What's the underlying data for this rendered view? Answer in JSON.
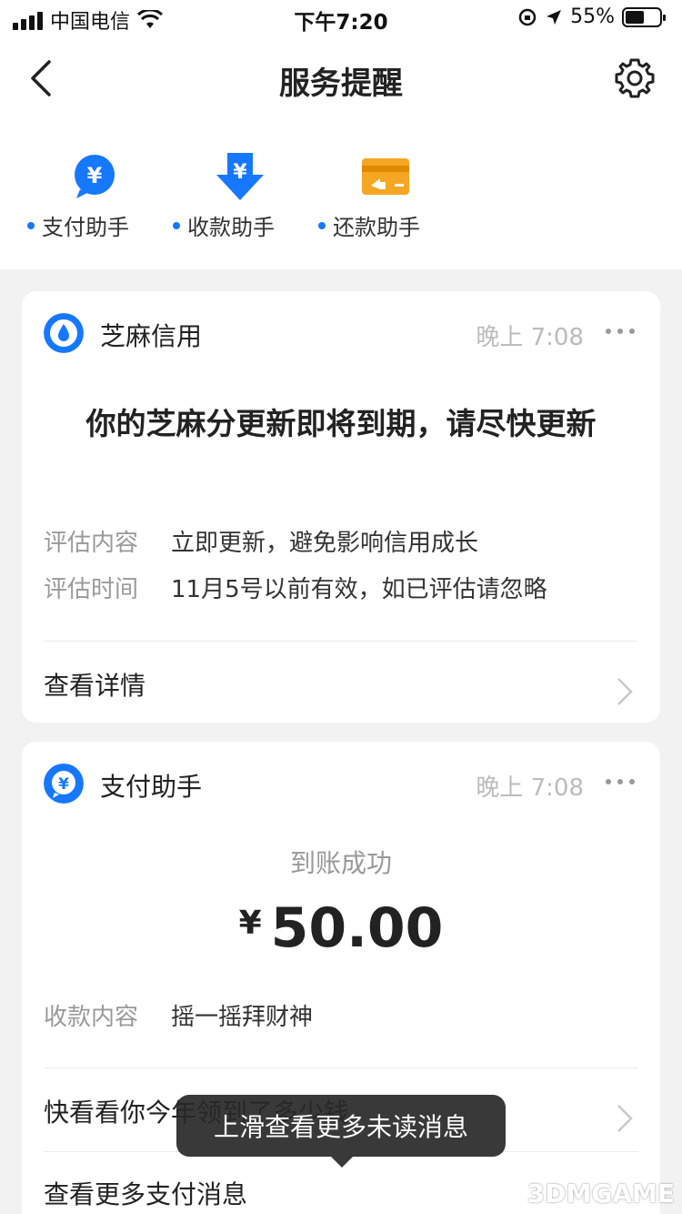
{
  "status_bar": {
    "carrier": "中国电信",
    "time": "下午7:20",
    "battery": "55%",
    "battery_level": 0.55
  },
  "nav": {
    "title": "服务提醒"
  },
  "shortcuts": [
    {
      "label": "支付助手",
      "icon": "yuan-bubble-icon"
    },
    {
      "label": "收款助手",
      "icon": "yuan-down-arrow-icon"
    },
    {
      "label": "还款助手",
      "icon": "card-repay-icon"
    }
  ],
  "card1": {
    "source": "芝麻信用",
    "time": "晚上 7:08",
    "headline": "你的芝麻分更新即将到期，请尽快更新",
    "rows": [
      {
        "key": "评估内容",
        "value": "立即更新，避免影响信用成长"
      },
      {
        "key": "评估时间",
        "value": "11月5号以前有效，如已评估请忽略"
      }
    ],
    "link": "查看详情"
  },
  "card2": {
    "source": "支付助手",
    "time": "晚上 7:08",
    "status": "到账成功",
    "currency": "¥",
    "amount": "50.00",
    "rows": [
      {
        "key": "收款内容",
        "value": "摇一摇拜财神"
      }
    ],
    "link1": "快看看你今年领到了多少钱",
    "link2": "查看更多支付消息"
  },
  "toast": "上滑查看更多未读消息",
  "watermark": "3DMGAME"
}
